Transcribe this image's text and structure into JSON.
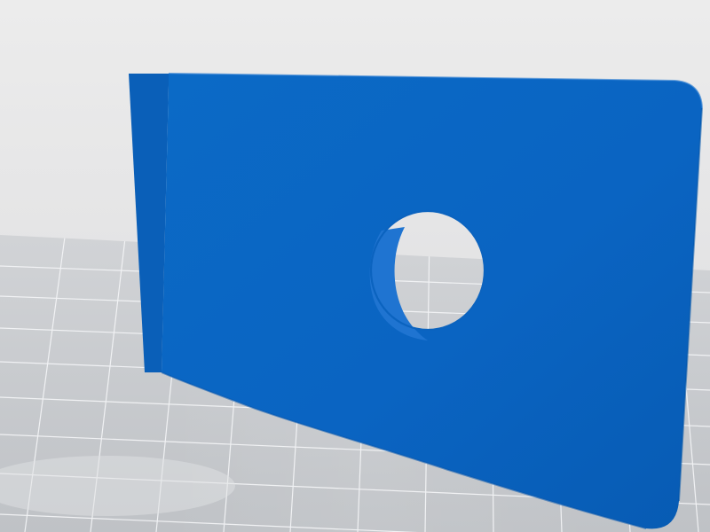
{
  "scene": {
    "background_color": "#e9e9e9",
    "build_plate": {
      "surface_color": "#c7c9cc",
      "grid_line_color": "#f3f4f6"
    },
    "part": {
      "shape": "rounded rectangular plate with circular hole",
      "color": "#0a64c2",
      "edge_color": "#0d5eb6",
      "shadow_color": "#d6d8dc",
      "hole_inner_wall_color": "#1e73d2"
    }
  }
}
